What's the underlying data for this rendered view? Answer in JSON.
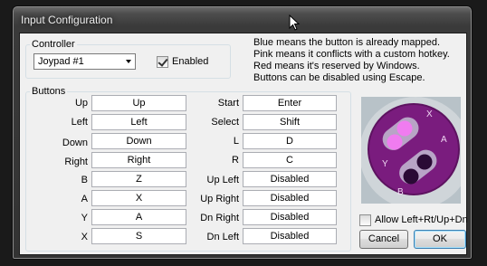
{
  "window": {
    "title": "Input Configuration"
  },
  "controller": {
    "group_label": "Controller",
    "selected": "Joypad #1",
    "enabled_label": "Enabled",
    "enabled_checked": true
  },
  "info_lines": [
    "Blue means the button is already mapped.",
    "Pink means it conflicts with a custom hotkey.",
    "Red means it's reserved by Windows.",
    "Buttons can be disabled using Escape."
  ],
  "buttons_group": {
    "label": "Buttons",
    "left": [
      {
        "label": "Up",
        "value": "Up"
      },
      {
        "label": "Left",
        "value": "Left"
      },
      {
        "label": "Down",
        "value": "Down"
      },
      {
        "label": "Right",
        "value": "Right"
      },
      {
        "label": "B",
        "value": "Z"
      },
      {
        "label": "A",
        "value": "X"
      },
      {
        "label": "Y",
        "value": "A"
      },
      {
        "label": "X",
        "value": "S"
      }
    ],
    "right": [
      {
        "label": "Start",
        "value": "Enter"
      },
      {
        "label": "Select",
        "value": "Shift"
      },
      {
        "label": "L",
        "value": "D"
      },
      {
        "label": "R",
        "value": "C"
      },
      {
        "label": "Up Left",
        "value": "Disabled"
      },
      {
        "label": "Up Right",
        "value": "Disabled"
      },
      {
        "label": "Dn Right",
        "value": "Disabled"
      },
      {
        "label": "Dn Left",
        "value": "Disabled"
      }
    ]
  },
  "pad_letters": {
    "x": "X",
    "y": "Y",
    "a": "A",
    "b": "B"
  },
  "allow_diagonals": {
    "label": "Allow Left+Rt/Up+Dn",
    "checked": false
  },
  "actions": {
    "cancel": "Cancel",
    "ok": "OK"
  },
  "colors": {
    "pad_purple": "#7a1c7e",
    "pink_highlight": "#f07cf0"
  }
}
